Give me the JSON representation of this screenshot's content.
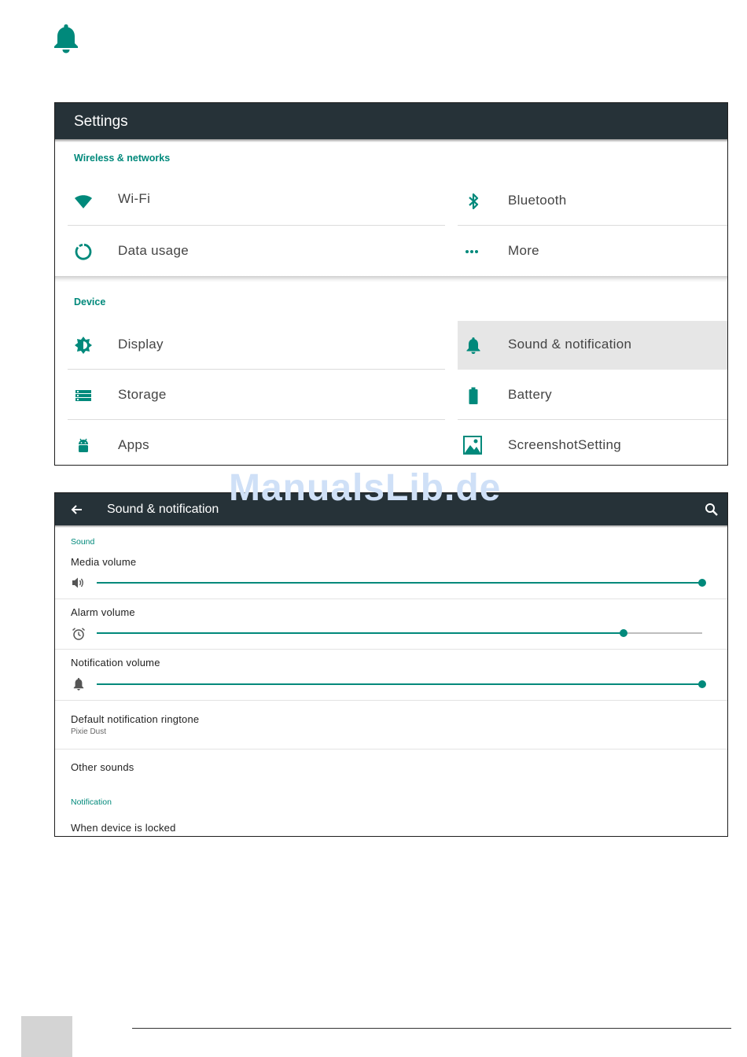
{
  "watermark": "ManualsLib.de",
  "colors": {
    "accent": "#00897b",
    "appbar": "#263238",
    "selected_bg": "#e6e6e6"
  },
  "header_icon": "bell-icon",
  "settings": {
    "title": "Settings",
    "wireless_section": "Wireless & networks",
    "device_section": "Device",
    "wireless_items": [
      {
        "label": "Wi-Fi",
        "icon": "wifi-icon"
      },
      {
        "label": "Bluetooth",
        "icon": "bluetooth-icon"
      },
      {
        "label": "Data usage",
        "icon": "data-usage-icon"
      },
      {
        "label": "More",
        "icon": "more-icon"
      }
    ],
    "device_items": [
      {
        "label": "Display",
        "icon": "brightness-icon"
      },
      {
        "label": "Sound & notification",
        "icon": "bell-icon",
        "selected": true
      },
      {
        "label": "Storage",
        "icon": "storage-icon"
      },
      {
        "label": "Battery",
        "icon": "battery-icon"
      },
      {
        "label": "Apps",
        "icon": "android-icon"
      },
      {
        "label": "ScreenshotSetting",
        "icon": "screenshot-icon"
      }
    ]
  },
  "sound": {
    "title": "Sound & notification",
    "back_icon": "arrow-back-icon",
    "search_icon": "search-icon",
    "sound_section": "Sound",
    "media_volume_label": "Media volume",
    "media_volume_level": 1.0,
    "alarm_volume_label": "Alarm volume",
    "alarm_volume_level": 0.87,
    "notification_volume_label": "Notification volume",
    "notification_volume_level": 1.0,
    "ringtone_label": "Default notification ringtone",
    "ringtone_value": "Pixie Dust",
    "other_sounds_label": "Other sounds",
    "notification_section": "Notification",
    "when_locked_label": "When device is locked"
  }
}
